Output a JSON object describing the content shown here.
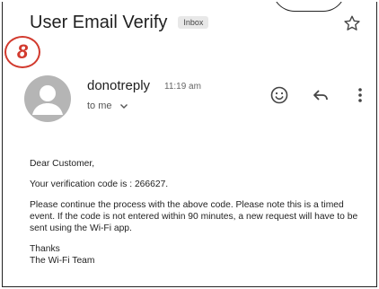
{
  "email": {
    "subject": "User Email Verify",
    "label": "Inbox",
    "sender": "donotreply",
    "time": "11:19 am",
    "recipient": "to me"
  },
  "annotation": {
    "step_number": "8",
    "color": "#d23a2e"
  },
  "icons": {
    "star": "star-outline-icon",
    "emoji": "emoji-reaction-icon",
    "reply": "reply-arrow-icon",
    "more": "more-vert-icon",
    "chevron": "chevron-down-icon",
    "avatar": "person-avatar-icon"
  },
  "message": {
    "greeting": "Dear Customer,",
    "code_line": "Your verification code is : 266627.",
    "instructions": "Please continue the process with the above code. Please note this is a timed event. If the code is not entered within 90 minutes, a new request will have to be sent using the Wi-Fi app.",
    "signoff": "Thanks",
    "signature": "The Wi-Fi Team"
  }
}
